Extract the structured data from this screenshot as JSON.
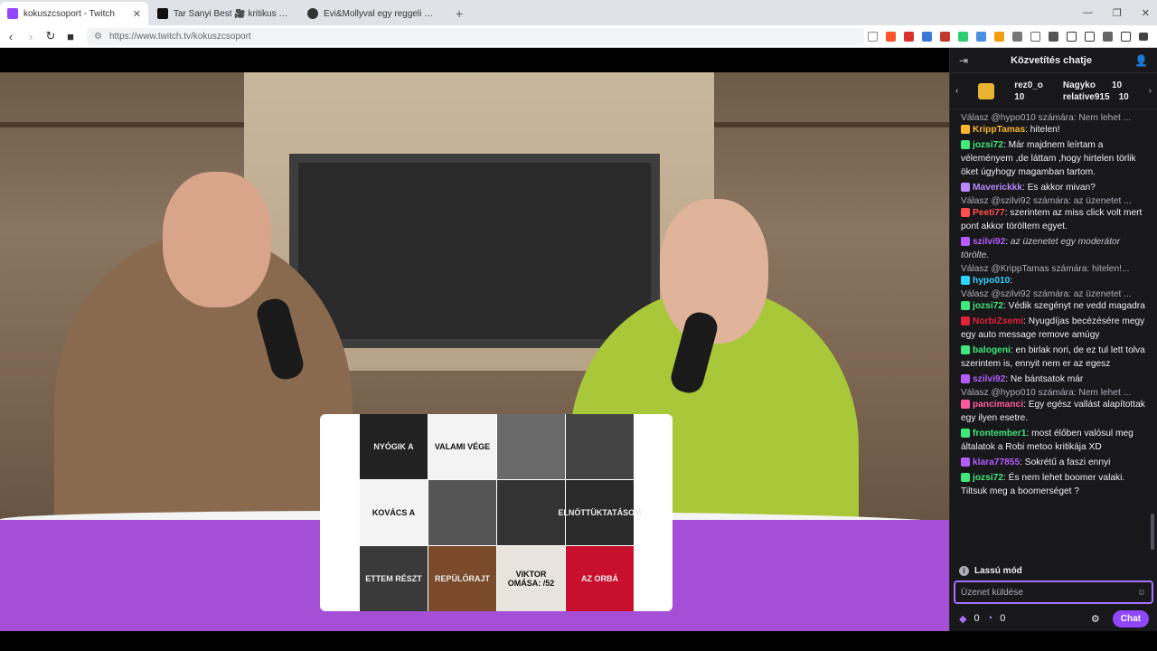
{
  "browser": {
    "tabs": [
      {
        "title": "kokuszcsoport - Twitch",
        "favicon_color": "#9147ff",
        "active": true
      },
      {
        "title": "Tar Sanyi Best 🎥 kritikus 🎥 (@szop",
        "favicon_color": "#111111",
        "active": false
      },
      {
        "title": "Évi&Mollyval egy reggeli 🍳😍 (@m",
        "favicon_color": "#333333",
        "active": false
      }
    ],
    "new_tab": "+",
    "url": "https://www.twitch.tv/kokuszcsoport"
  },
  "chat": {
    "title": "Közvetítés chatje",
    "leaderboard": [
      {
        "name": "rez0_o",
        "count": "10"
      },
      {
        "name": "Nagyko",
        "count": "10"
      },
      {
        "name": "relative915",
        "count": "10"
      }
    ],
    "messages": [
      {
        "reply": "Válasz @hypo010 számára: Nem lehet ..."
      },
      {
        "user": "KrippTamas",
        "color": "#ffb62a",
        "text": ": hitelen!"
      },
      {
        "user": "jozsi72",
        "color": "#3ee87a",
        "text": ": Már majdnem leírtam a véleményem ,de láttam ,hogy hirtelen törlik öket úgyhogy magamban tartom."
      },
      {
        "user": "Maverickkk",
        "color": "#b889ff",
        "text": ": Es akkor mivan?"
      },
      {
        "reply": "Válasz @szilvi92 számára: az üzenetet ..."
      },
      {
        "user": "Peeti77",
        "color": "#ff4f4f",
        "text": ": szerintem az miss click volt mert pont akkor töröltem egyet."
      },
      {
        "user": "szilvi92",
        "color": "#b45cff",
        "text": ": ",
        "italic": "az üzenetet egy moderátor törölte."
      },
      {
        "reply": "Válasz @KrippTamas számára: hitelen!..."
      },
      {
        "user": "hypo010",
        "color": "#2fd3ff",
        "text": ":"
      },
      {
        "reply": "Válasz @szilvi92 számára: az üzenetet ..."
      },
      {
        "user": "jozsi72",
        "color": "#3ee87a",
        "text": ": Védik szegényt ne vedd magadra"
      },
      {
        "user": "NorbiZsemi",
        "color": "#e0213a",
        "text": ": Nyugdíjas becézésére megy egy auto message remove amúgy"
      },
      {
        "user": "balogeni",
        "color": "#3ee87a",
        "text": ": en birlak nori, de ez tul lett tolva szerintem is, ennyit nem er az egesz"
      },
      {
        "user": "szilvi92",
        "color": "#b45cff",
        "text": ": Ne bántsatok már"
      },
      {
        "reply": "Válasz @hypo010 számára: Nem lehet ..."
      },
      {
        "user": "pancimanci",
        "color": "#ff5aa0",
        "text": ": Egy egész vallást alapítottak egy ilyen esetre."
      },
      {
        "user": "frontember1",
        "color": "#3ee87a",
        "text": ": most élőben valósul meg általatok a Robi metoo kritikája XD"
      },
      {
        "user": "klara77855",
        "color": "#b45cff",
        "text": ": Sokrétű a faszi ennyi"
      },
      {
        "user": "jozsi72",
        "color": "#3ee87a",
        "text": ": És nem lehet boomer valaki. Tiltsuk meg a boomerséget ?"
      }
    ],
    "slow_mode": "Lassú mód",
    "input_placeholder": "Üzenet küldése",
    "points_a": "0",
    "points_b": "0",
    "send_label": "Chat"
  },
  "video": {
    "screenshot_tiles": [
      "NYÓGIK A",
      "VALAMI VÉGE",
      "",
      "",
      "KOVÁCS A",
      "",
      "",
      "ELNÖTTÜKTATÁSOM",
      "ETTEM RÉSZT",
      "REPÜLŐRAJT",
      "VIKTOR OMÁSA: /52",
      "AZ ORBÁ"
    ]
  },
  "colors": {
    "accent": "#9147ff",
    "wave": "#a44fd6"
  }
}
